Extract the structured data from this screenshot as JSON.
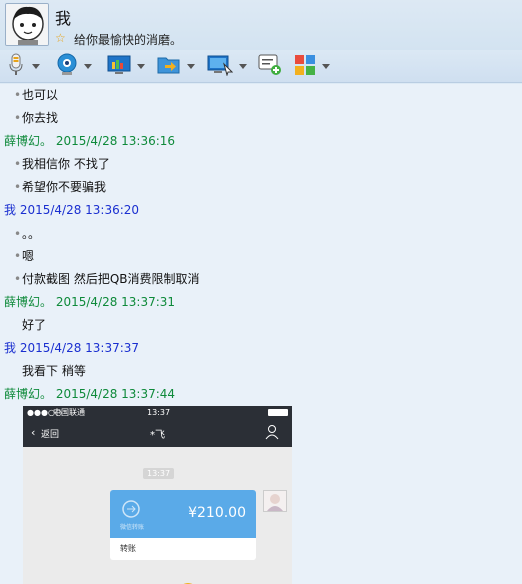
{
  "header": {
    "contact_name": "我",
    "signature": "给你最愉快的消磨。"
  },
  "toolbar": {
    "buttons": [
      {
        "name": "microphone-icon"
      },
      {
        "name": "camera-icon"
      },
      {
        "name": "screen-share-icon"
      },
      {
        "name": "file-transfer-icon"
      },
      {
        "name": "remote-desktop-icon"
      },
      {
        "name": "add-message-icon"
      },
      {
        "name": "apps-icon"
      }
    ]
  },
  "messages": [
    {
      "type": "text",
      "text": "也可以"
    },
    {
      "type": "text",
      "text": "你去找"
    },
    {
      "type": "header",
      "who": "them",
      "text": "薛博幻。 2015/4/28 13:36:16"
    },
    {
      "type": "text",
      "text": "我相信你 不找了"
    },
    {
      "type": "text",
      "text": "希望你不要骗我"
    },
    {
      "type": "header",
      "who": "me",
      "text": "我 2015/4/28 13:36:20"
    },
    {
      "type": "text",
      "text": "。。"
    },
    {
      "type": "text",
      "text": "嗯"
    },
    {
      "type": "text",
      "text": "付款截图 然后把QB消费限制取消"
    },
    {
      "type": "header",
      "who": "them",
      "text": "薛博幻。 2015/4/28 13:37:31"
    },
    {
      "type": "plain",
      "text": "好了"
    },
    {
      "type": "header",
      "who": "me",
      "text": "我 2015/4/28 13:37:37"
    },
    {
      "type": "plain",
      "text": "我看下 稍等"
    },
    {
      "type": "header",
      "who": "them",
      "text": "薛博幻。 2015/4/28 13:37:44"
    }
  ],
  "screenshot": {
    "carrier": "中国联通",
    "status_time": "13:37",
    "back_label": "返回",
    "chat_title": "*飞",
    "msg_time": "13:37",
    "amount": "¥210.00",
    "transfer_label": "转账",
    "transfer_tag": "微信转账"
  },
  "colors": {
    "them": "#0e8a3a",
    "me": "#1a2fd0",
    "transfer_blue": "#5aaae8"
  }
}
